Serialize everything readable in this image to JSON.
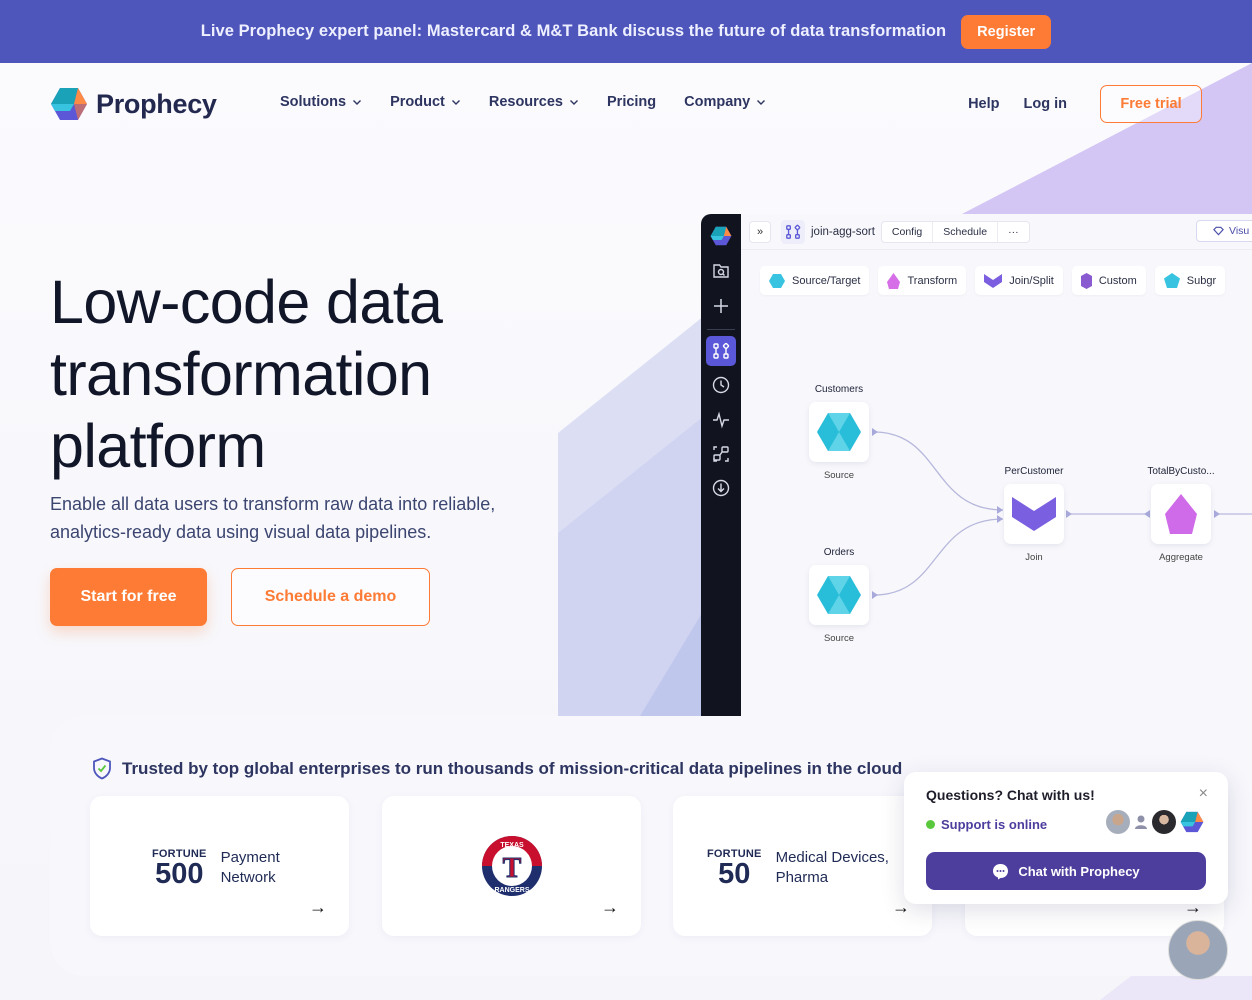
{
  "announcement": {
    "text": "Live Prophecy expert panel: Mastercard & M&T Bank discuss the future of data transformation",
    "button_label": "Register"
  },
  "nav": {
    "logo_text": "Prophecy",
    "items": [
      {
        "label": "Solutions",
        "has_dropdown": true
      },
      {
        "label": "Product",
        "has_dropdown": true
      },
      {
        "label": "Resources",
        "has_dropdown": true
      },
      {
        "label": "Pricing",
        "has_dropdown": false
      },
      {
        "label": "Company",
        "has_dropdown": true
      }
    ],
    "help_label": "Help",
    "login_label": "Log in",
    "free_trial_label": "Free trial"
  },
  "hero": {
    "title_lines": [
      "Low-code data",
      "transformation",
      "platform"
    ],
    "subtitle": "Enable all data users to transform raw data into reliable, analytics-ready data using visual data pipelines.",
    "primary_cta": "Start for free",
    "secondary_cta": "Schedule a demo"
  },
  "app": {
    "rail_icons": [
      "prophecy-logo-icon",
      "folder-search-icon",
      "plus-icon",
      "pipeline-icon",
      "clock-icon",
      "activity-icon",
      "graph-icon",
      "download-icon"
    ],
    "expand_label": "»",
    "pipeline_name": "join-agg-sort",
    "tabs": [
      "Config",
      "Schedule",
      "···"
    ],
    "visual_label": "Visu",
    "palette": [
      {
        "label": "Source/Target",
        "icon": "hexagon-icon",
        "color": "#38c3e0"
      },
      {
        "label": "Transform",
        "icon": "drop-icon",
        "color": "#d66ee8"
      },
      {
        "label": "Join/Split",
        "icon": "chevron-gem-icon",
        "color": "#7b5fe0"
      },
      {
        "label": "Custom",
        "icon": "crystal-icon",
        "color": "#8a5ad0"
      },
      {
        "label": "Subgr",
        "icon": "pentagon-icon",
        "color": "#38c3e0"
      }
    ],
    "nodes": [
      {
        "title": "Customers",
        "sub": "Source",
        "kind": "source"
      },
      {
        "title": "Orders",
        "sub": "Source",
        "kind": "source"
      },
      {
        "title": "PerCustomer",
        "sub": "Join",
        "kind": "join"
      },
      {
        "title": "TotalByCusto...",
        "sub": "Aggregate",
        "kind": "aggregate"
      }
    ]
  },
  "trusted": {
    "headline": "Trusted by top global enterprises to run thousands of mission-critical data pipelines in the cloud",
    "cards": [
      {
        "type": "fortune",
        "fortune_word": "FORTUNE",
        "fortune_num": "500",
        "desc_lines": [
          "Payment",
          "Network"
        ]
      },
      {
        "type": "logo",
        "logo": "texas-rangers-logo",
        "logo_top": "TEXAS",
        "logo_bottom": "RANGERS",
        "logo_letter": "T"
      },
      {
        "type": "fortune",
        "fortune_word": "FORTUNE",
        "fortune_num": "50",
        "desc_lines": [
          "Medical Devices,",
          "Pharma"
        ]
      },
      {
        "type": "hidden"
      }
    ],
    "arrow": "→"
  },
  "chat": {
    "title": "Questions? Chat with us!",
    "close": "×",
    "status": "Support is online",
    "button_label": "Chat with Prophecy",
    "status_color": "#5ac83d"
  },
  "colors": {
    "accent": "#fd7b35",
    "banner": "#4e55bb",
    "chat_purple": "#4d3e9e",
    "rail_active": "#5a58d8"
  }
}
